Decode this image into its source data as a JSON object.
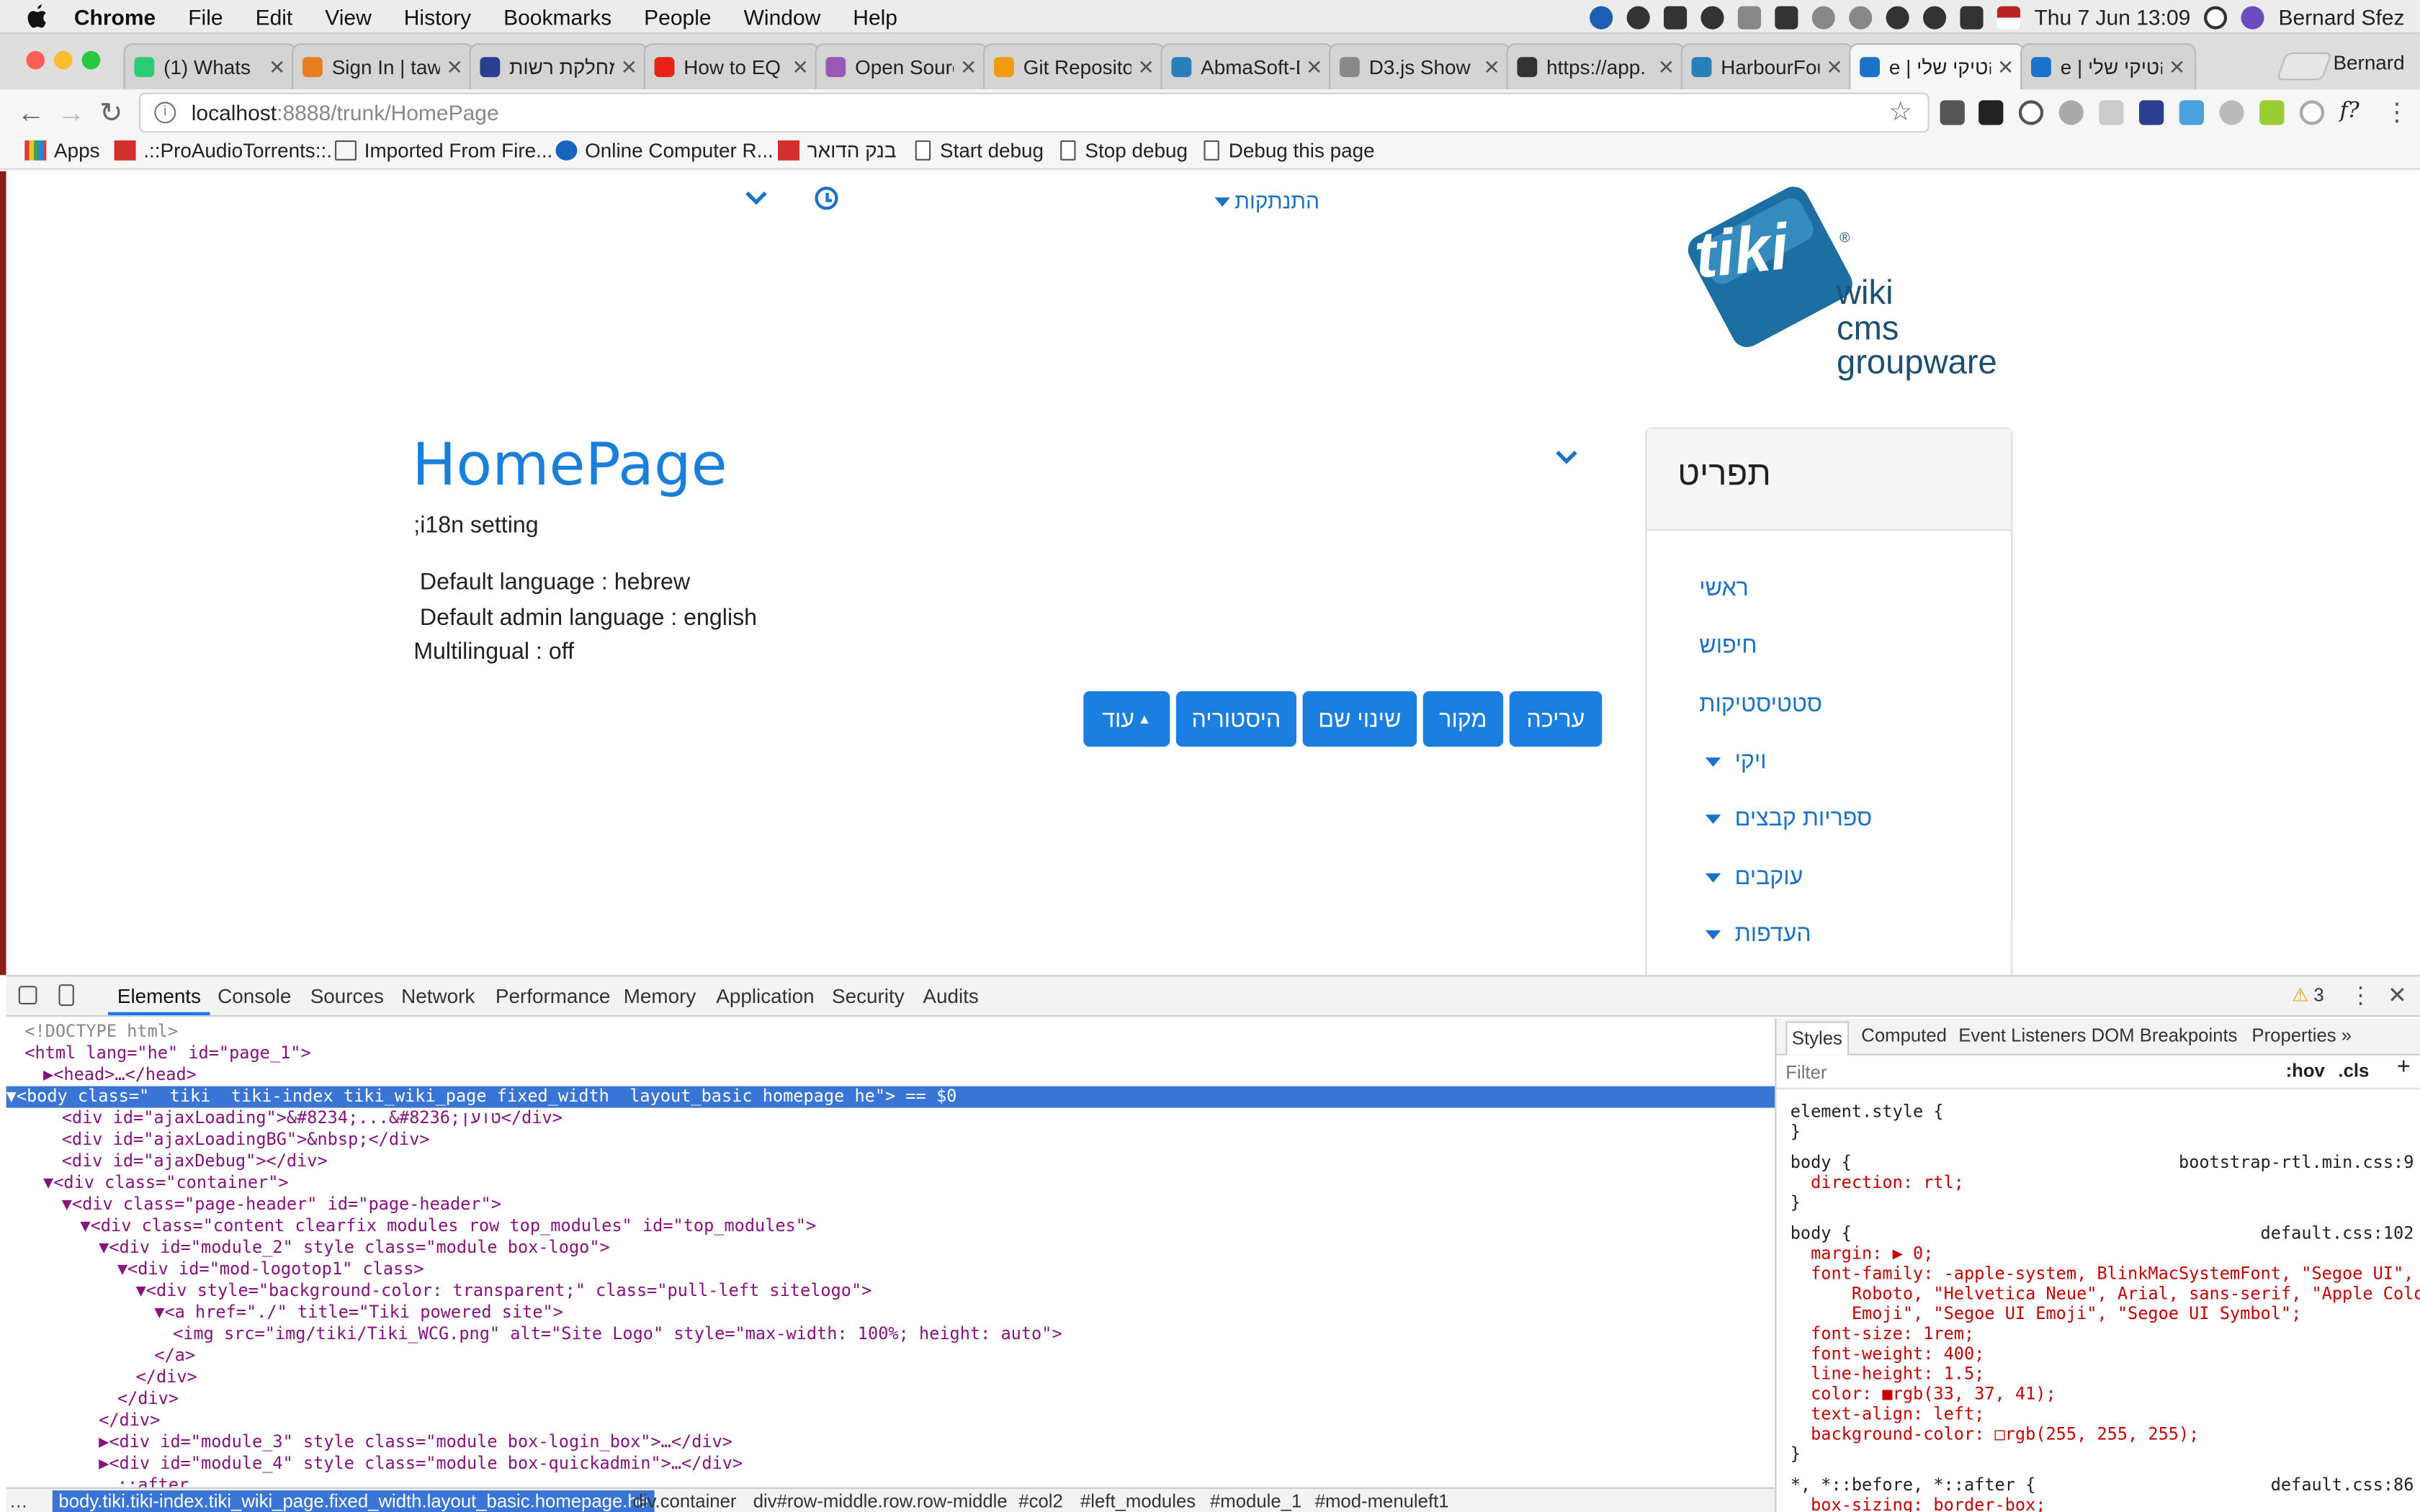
{
  "menubar": {
    "items": [
      "Chrome",
      "File",
      "Edit",
      "View",
      "History",
      "Bookmarks",
      "People",
      "Window",
      "Help"
    ],
    "datetime": "Thu 7 Jun  13:09",
    "user": "Bernard Sfez"
  },
  "tabs": [
    {
      "label": "(1) Whats",
      "fav": "#2ecc71"
    },
    {
      "label": "Sign In | taw",
      "fav": "#e67e22"
    },
    {
      "label": "מחלקת רשות",
      "fav": "#2c3e90"
    },
    {
      "label": "How to EQ K",
      "fav": "#e62117"
    },
    {
      "label": "Open Source",
      "fav": "#9b59b6"
    },
    {
      "label": "Git Repositor",
      "fav": "#f39c12"
    },
    {
      "label": "AbmaSoft-D",
      "fav": "#2980b9"
    },
    {
      "label": "D3.js Show",
      "fav": "#888888"
    },
    {
      "label": "https://app.",
      "fav": "#333333"
    },
    {
      "label": "HarbourFou",
      "fav": "#2980b9"
    },
    {
      "label": "e | הטיקי שלי",
      "fav": "#1a73c9"
    },
    {
      "label": "e | הטיקי שלי",
      "fav": "#1a73c9"
    }
  ],
  "profile_name": "Bernard",
  "toolbar": {
    "url_host": "localhost",
    "url_path": ":8888/trunk/HomePage"
  },
  "bookmarks": [
    "Apps",
    ".::ProAudioTorrents::.",
    "Imported From Fire...",
    "Online Computer R...",
    "בנק הדואר",
    "Start debug",
    "Stop debug",
    "Debug this page"
  ],
  "page": {
    "top_nav_label": "התנתקות",
    "logo": {
      "brand": "tiki",
      "line1": "wiki",
      "line2": "cms",
      "line3": "groupware"
    },
    "title": "HomePage",
    "heading": ";i18n setting",
    "lines": [
      "Default language : hebrew",
      "Default admin language : english",
      "Multilingual : off"
    ],
    "buttons": {
      "edit": "עריכה",
      "source": "מקור",
      "rename": "שינוי שם",
      "history": "היסטוריה",
      "more": "עוד"
    },
    "menu": {
      "title": "תפריט",
      "items": [
        "ראשי",
        "חיפוש",
        "סטטיסטיקות"
      ],
      "groups": [
        "ויקי",
        "ספריות קבצים",
        "עוקבים",
        "העדפות"
      ]
    }
  },
  "devtools": {
    "tabs": [
      "Elements",
      "Console",
      "Sources",
      "Network",
      "Performance",
      "Memory",
      "Application",
      "Security",
      "Audits"
    ],
    "warnings": "3",
    "dom": [
      {
        "i": 0,
        "t": "<!DOCTYPE html>"
      },
      {
        "i": 0,
        "t": "<html lang=\"he\" id=\"page_1\">"
      },
      {
        "i": 1,
        "t": "▶<head>…</head>"
      },
      {
        "i": 0,
        "t": "▼<body class=\"  tiki  tiki-index tiki_wiki_page fixed_width  layout_basic homepage he\"> == $0"
      },
      {
        "i": 2,
        "t": "<div id=\"ajaxLoading\">&#8234;...&#8236;טוען</div>"
      },
      {
        "i": 2,
        "t": "<div id=\"ajaxLoadingBG\">&nbsp;</div>"
      },
      {
        "i": 2,
        "t": "<div id=\"ajaxDebug\"></div>"
      },
      {
        "i": 1,
        "t": "▼<div class=\"container\">"
      },
      {
        "i": 2,
        "t": "▼<div class=\"page-header\" id=\"page-header\">"
      },
      {
        "i": 3,
        "t": "▼<div class=\"content clearfix modules row top_modules\" id=\"top_modules\">"
      },
      {
        "i": 4,
        "t": "▼<div id=\"module_2\" style class=\"module box-logo\">"
      },
      {
        "i": 5,
        "t": "▼<div id=\"mod-logotop1\" class>"
      },
      {
        "i": 6,
        "t": "▼<div style=\"background-color: transparent;\" class=\"pull-left sitelogo\">"
      },
      {
        "i": 7,
        "t": "▼<a href=\"./\" title=\"Tiki powered site\">"
      },
      {
        "i": 8,
        "t": "<img src=\"img/tiki/Tiki_WCG.png\" alt=\"Site Logo\" style=\"max-width: 100%; height: auto\">"
      },
      {
        "i": 7,
        "t": "</a>"
      },
      {
        "i": 6,
        "t": "</div>"
      },
      {
        "i": 5,
        "t": "</div>"
      },
      {
        "i": 4,
        "t": "</div>"
      },
      {
        "i": 4,
        "t": "▶<div id=\"module_3\" style class=\"module box-login_box\">…</div>"
      },
      {
        "i": 4,
        "t": "▶<div id=\"module_4\" style class=\"module box-quickadmin\">…</div>"
      },
      {
        "i": 5,
        "t": "::after"
      }
    ],
    "breadcrumbs": [
      "body.tiki.tiki-index.tiki_wiki_page.fixed_width.layout_basic.homepage.he",
      "div.container",
      "div#row-middle.row.row-middle",
      "#col2",
      "#left_modules",
      "#module_1",
      "#mod-menuleft1"
    ],
    "styles_tabs": [
      "Styles",
      "Computed",
      "Event Listeners",
      "DOM Breakpoints",
      "Properties"
    ],
    "filter_placeholder": "Filter",
    "hov": ":hov",
    "cls": ".cls",
    "styles": [
      {
        "t": "element.style {"
      },
      {
        "t": "}"
      },
      {
        "t": "body {",
        "src": "bootstrap-rtl.min.css:9"
      },
      {
        "t": "  direction: rtl;"
      },
      {
        "t": "}"
      },
      {
        "t": "body {",
        "src": "default.css:102"
      },
      {
        "t": "  margin: ▶ 0;"
      },
      {
        "t": "  font-family: -apple-system, BlinkMacSystemFont, \"Segoe UI\","
      },
      {
        "t": "      Roboto, \"Helvetica Neue\", Arial, sans-serif, \"Apple Color"
      },
      {
        "t": "      Emoji\", \"Segoe UI Emoji\", \"Segoe UI Symbol\";"
      },
      {
        "t": "  font-size: 1rem;"
      },
      {
        "t": "  font-weight: 400;"
      },
      {
        "t": "  line-height: 1.5;"
      },
      {
        "t": "  color: ■rgb(33, 37, 41);"
      },
      {
        "t": "  text-align: left;"
      },
      {
        "t": "  background-color: □rgb(255, 255, 255);"
      },
      {
        "t": "}"
      },
      {
        "t": "*, *::before, *::after {",
        "src": "default.css:86"
      },
      {
        "t": "  box-sizing: border-box;"
      }
    ]
  }
}
